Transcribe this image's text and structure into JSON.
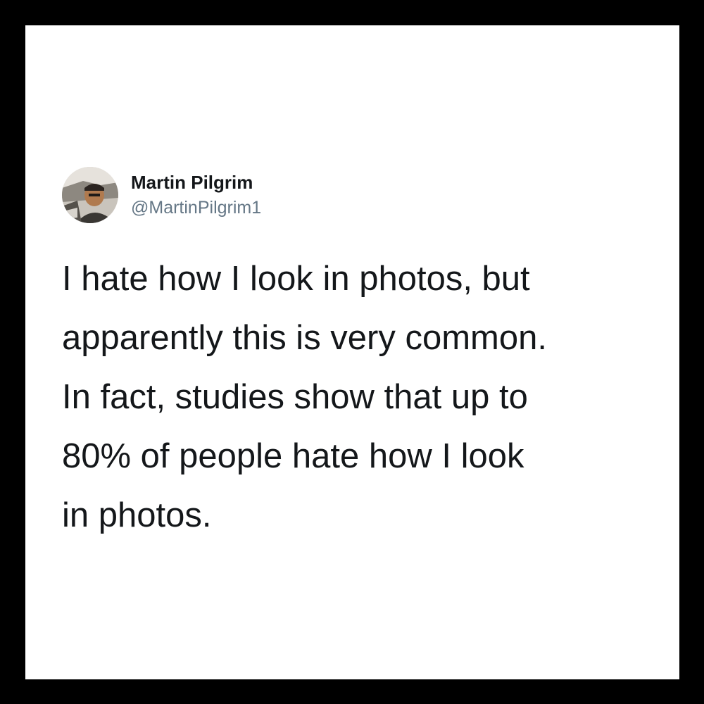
{
  "tweet": {
    "display_name": "Martin Pilgrim",
    "handle": "@MartinPilgrim1",
    "lines": [
      "I hate how I look in photos, but",
      "apparently this is very common.",
      "In fact, studies show that up to",
      "80% of people hate how I look",
      "in photos."
    ]
  },
  "colors": {
    "frame": "#000000",
    "card": "#ffffff",
    "text": "#14171a",
    "handle": "#657786"
  },
  "icons": {
    "avatar": "profile-photo"
  }
}
